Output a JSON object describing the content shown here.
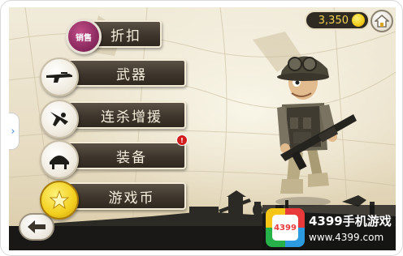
{
  "menu": [
    {
      "id": "discount",
      "label": "折扣",
      "icon": "sale-badge-icon",
      "icon_text": "销售"
    },
    {
      "id": "weapons",
      "label": "武器",
      "icon": "rifle-icon"
    },
    {
      "id": "killstreak",
      "label": "连杀增援",
      "icon": "airplane-icon"
    },
    {
      "id": "equipment",
      "label": "装备",
      "icon": "helmet-icon",
      "badge": "!"
    },
    {
      "id": "coins",
      "label": "游戏币",
      "icon": "star-coin-icon"
    }
  ],
  "currency": {
    "amount": "3,350",
    "icon": "coin-icon"
  },
  "watermark": {
    "logo_text": "4399",
    "title": "4399手机游戏",
    "url": "www.4399.com"
  },
  "colors": {
    "button_bg": "#3e362d",
    "button_border": "#f4ecd6",
    "coin": "#f2cf1e",
    "badge": "#d21d1d",
    "ground": "#191816"
  }
}
